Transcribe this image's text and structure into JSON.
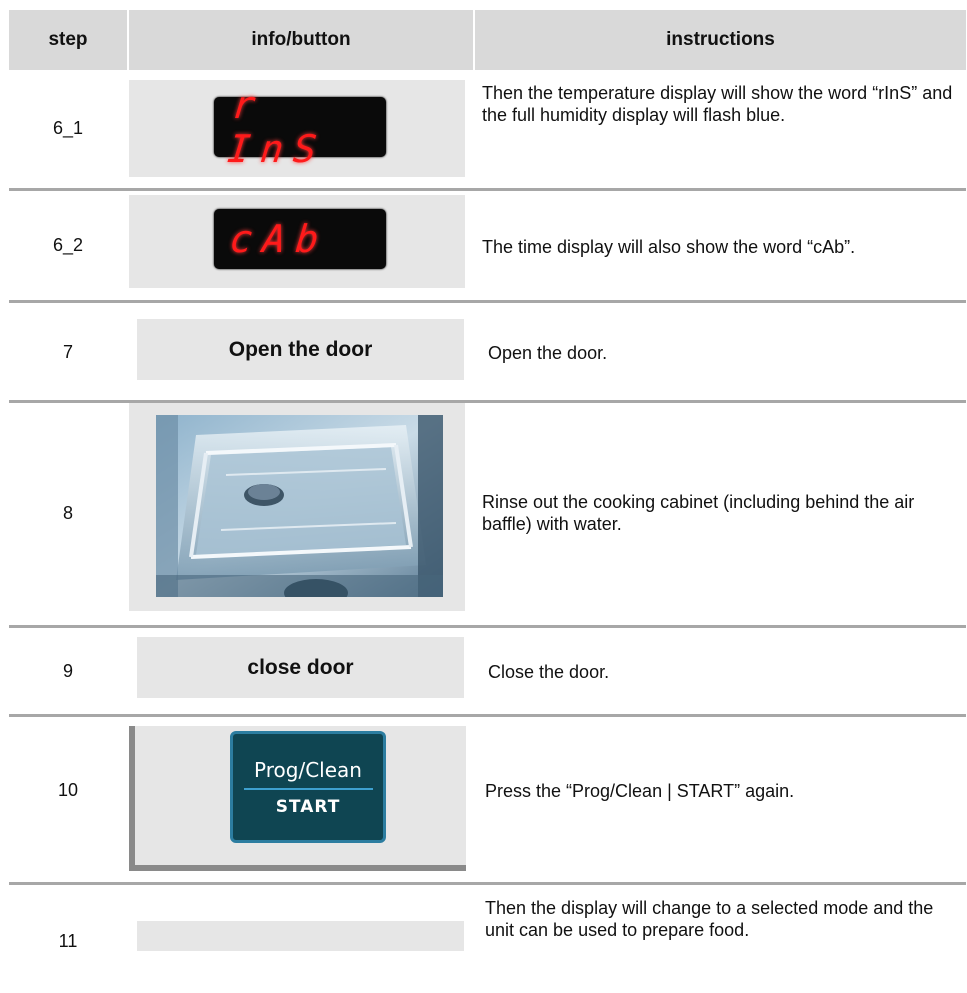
{
  "header": {
    "step": "step",
    "info": "info/button",
    "instructions": "instructions"
  },
  "rows": [
    {
      "step": "6_1",
      "display": "r InS",
      "instructions": "Then the temperature display will show the word “rInS” and the full humidity display will flash blue."
    },
    {
      "step": "6_2",
      "display": "cAb",
      "instructions": "The time display will also show the word “cAb”."
    },
    {
      "step": "7",
      "button": "Open the door",
      "instructions": "Open the door."
    },
    {
      "step": "8",
      "image": "cooking-cabinet-photo",
      "instructions": "Rinse out the cooking cabinet (including behind the air baffle) with water."
    },
    {
      "step": "9",
      "button": "close door",
      "instructions": "Close the door."
    },
    {
      "step": "10",
      "prog_top": "Prog/Clean",
      "prog_bottom": "START",
      "instructions": "Press the “Prog/Clean | START” again."
    },
    {
      "step": "11",
      "instructions": "Then the display will change to a selected mode and the unit can be used to prepare food."
    }
  ],
  "colors": {
    "led_red": "#ff1a1a",
    "prog_button": "#0f4552",
    "header_bg": "#d9d9d9",
    "cell_bg": "#e6e6e6"
  }
}
